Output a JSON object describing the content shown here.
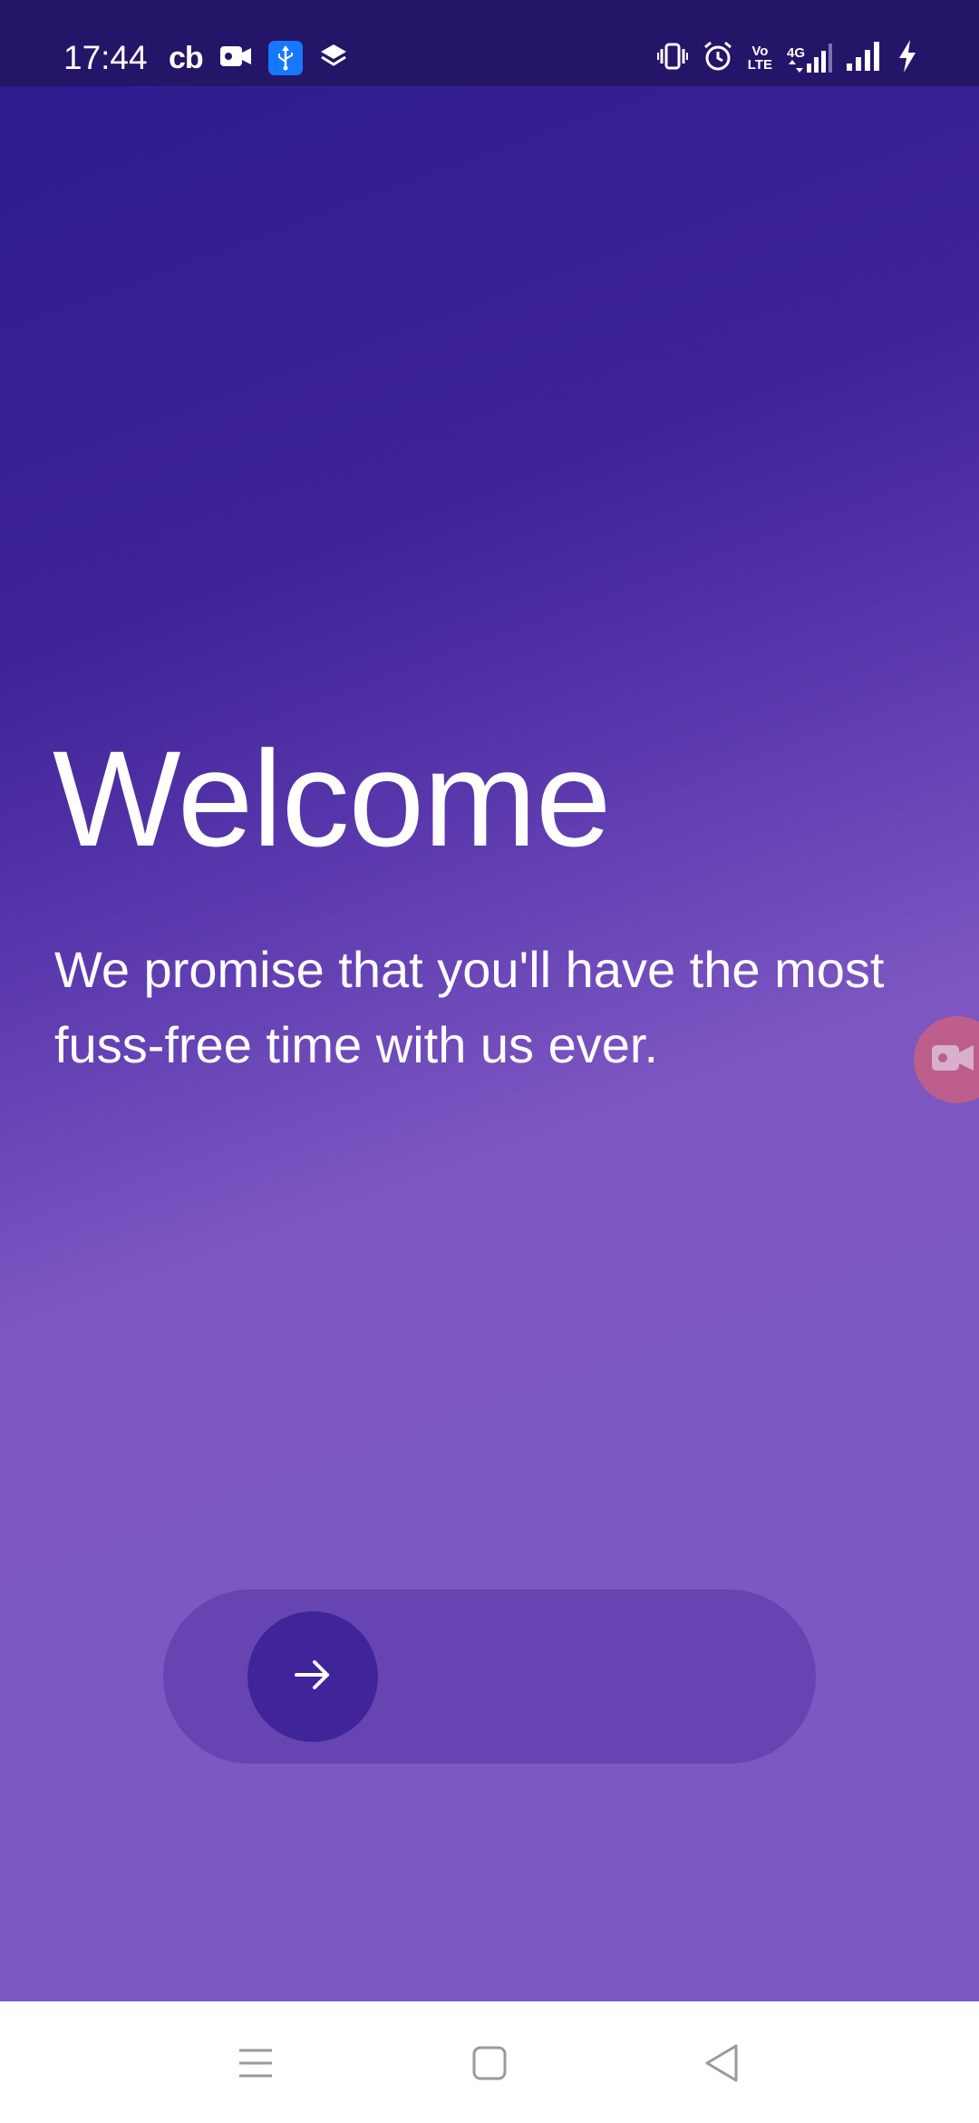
{
  "status_bar": {
    "time": "17:44",
    "left_icons": [
      "cb-app-icon",
      "video-camera-icon",
      "usb-icon",
      "layers-icon"
    ],
    "cb_label": "cb",
    "volte_top": "Vo",
    "volte_bottom": "LTE",
    "network_label": "4G",
    "right_icons": [
      "vibrate-icon",
      "alarm-icon",
      "volte-icon",
      "mobile-data-4g-icon",
      "signal-icon",
      "charging-icon"
    ]
  },
  "welcome": {
    "title": "Welcome",
    "subtitle": "We promise that you'll have the most fuss-free time with us ever."
  },
  "slider": {
    "knob_icon": "arrow-right-icon"
  },
  "floating": {
    "icon": "video-record-icon"
  },
  "nav_bar": {
    "buttons": [
      "menu-icon",
      "home-icon",
      "back-icon"
    ]
  },
  "colors": {
    "status_bar_bg": "#241569",
    "gradient_top": "#2f1c8f",
    "gradient_bottom": "#7e58c2",
    "slider_track": "#6645b2",
    "slider_knob": "#3f249a",
    "text": "#ffffff"
  }
}
